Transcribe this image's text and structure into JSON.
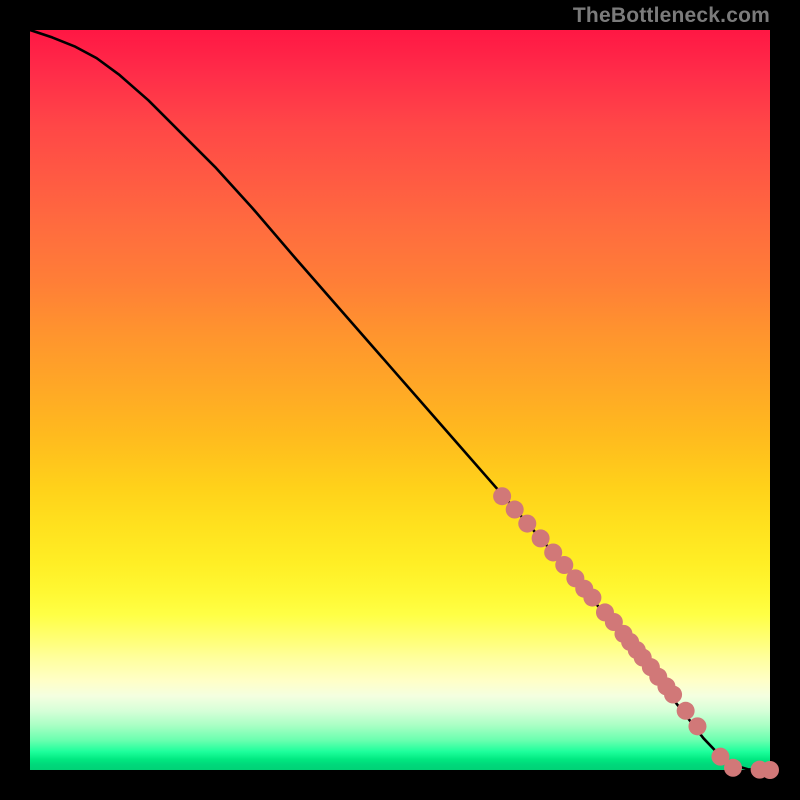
{
  "attribution": "TheBottleneck.com",
  "colors": {
    "line": "#000000",
    "marker_fill": "#d17878",
    "marker_stroke": "#c86a6a"
  },
  "chart_data": {
    "type": "line",
    "title": "",
    "xlabel": "",
    "ylabel": "",
    "xlim": [
      0,
      100
    ],
    "ylim": [
      0,
      100
    ],
    "grid": false,
    "legend": false,
    "series": [
      {
        "name": "curve",
        "type": "line",
        "x": [
          0,
          3,
          6,
          9,
          12,
          16,
          20,
          25,
          30,
          36,
          43,
          50,
          57,
          64,
          71,
          76,
          80,
          83,
          86,
          89,
          91,
          93,
          95,
          97,
          98.5,
          100
        ],
        "y": [
          100,
          99,
          97.8,
          96.2,
          94,
          90.5,
          86.5,
          81.5,
          76,
          69,
          61,
          53,
          45,
          37,
          29,
          23,
          18.5,
          14.5,
          10.7,
          6.9,
          4.3,
          2.2,
          0.7,
          0.1,
          0.03,
          0
        ]
      },
      {
        "name": "markers",
        "type": "scatter",
        "x": [
          63.8,
          65.5,
          67.2,
          69.0,
          70.7,
          72.2,
          73.7,
          74.9,
          76.0,
          77.7,
          78.9,
          80.2,
          81.1,
          82.0,
          82.8,
          83.9,
          84.9,
          86.0,
          86.9,
          88.6,
          90.2,
          93.3,
          95.0,
          98.6,
          100
        ],
        "y": [
          37.0,
          35.2,
          33.3,
          31.3,
          29.4,
          27.7,
          25.9,
          24.5,
          23.3,
          21.3,
          20.0,
          18.4,
          17.3,
          16.2,
          15.2,
          13.9,
          12.6,
          11.3,
          10.2,
          8.0,
          5.9,
          1.8,
          0.3,
          0.05,
          0
        ]
      }
    ]
  }
}
